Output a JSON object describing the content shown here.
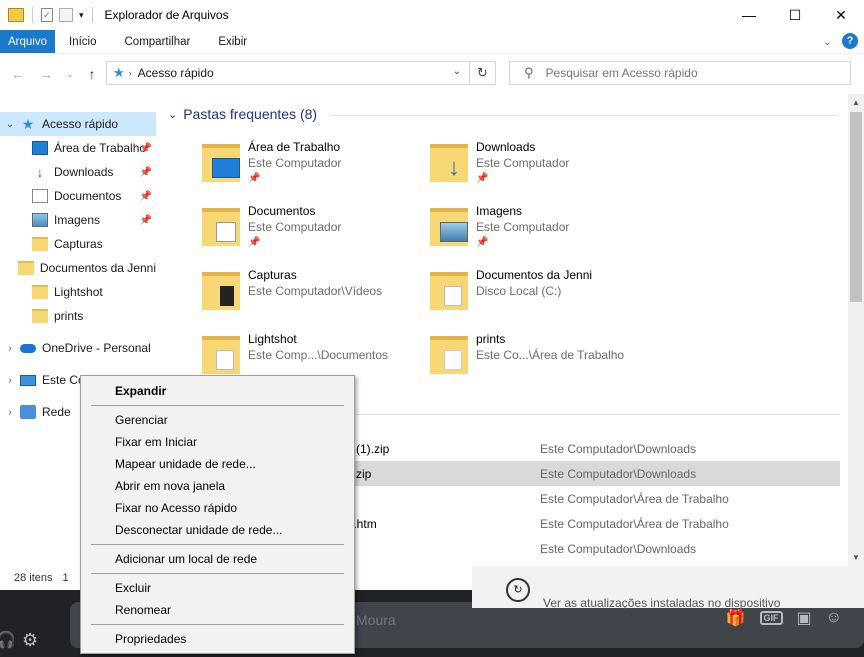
{
  "window": {
    "title": "Explorador de Arquivos",
    "controls": {
      "minimize": "—",
      "maximize": "☐",
      "close": "✕"
    }
  },
  "ribbon": {
    "tabs": [
      "Arquivo",
      "Início",
      "Compartilhar",
      "Exibir"
    ]
  },
  "address": {
    "crumb": "Acesso rápido",
    "search_placeholder": "Pesquisar em Acesso rápido"
  },
  "nav": {
    "quick_access": "Acesso rápido",
    "items": [
      {
        "label": "Área de Trabalho",
        "icon": "desktop-icon",
        "pinned": true
      },
      {
        "label": "Downloads",
        "icon": "download-icon",
        "pinned": true
      },
      {
        "label": "Documentos",
        "icon": "document-icon",
        "pinned": true
      },
      {
        "label": "Imagens",
        "icon": "image-icon",
        "pinned": true
      },
      {
        "label": "Capturas",
        "icon": "folder-icon",
        "pinned": false
      },
      {
        "label": "Documentos da Jenni",
        "icon": "folder-icon",
        "pinned": false
      },
      {
        "label": "Lightshot",
        "icon": "folder-icon",
        "pinned": false
      },
      {
        "label": "prints",
        "icon": "folder-icon",
        "pinned": false
      }
    ],
    "onedrive": "OneDrive - Personal",
    "this_pc": "Este Co",
    "network": "Rede"
  },
  "content": {
    "group_title": "Pastas frequentes (8)",
    "folders": [
      {
        "name": "Área de Trabalho",
        "location": "Este Computador",
        "pinned": true
      },
      {
        "name": "Downloads",
        "location": "Este Computador",
        "pinned": true
      },
      {
        "name": "Documentos",
        "location": "Este Computador",
        "pinned": true
      },
      {
        "name": "Imagens",
        "location": "Este Computador",
        "pinned": true
      },
      {
        "name": "Capturas",
        "location": "Este Computador\\Vídeos",
        "pinned": false
      },
      {
        "name": "Documentos da Jenni",
        "location": "Disco Local (C:)",
        "pinned": false
      },
      {
        "name": "Lightshot",
        "location": "Este Comp...\\Documentos",
        "pinned": false
      },
      {
        "name": "prints",
        "location": "Este Co...\\Área de Trabalho",
        "pinned": false
      }
    ],
    "recent": [
      {
        "name": "ox (1).zip",
        "path": "Este Computador\\Downloads",
        "highlighted": false
      },
      {
        "name": "ox.zip",
        "path": "Este Computador\\Downloads",
        "highlighted": true
      },
      {
        "name": "",
        "path": "Este Computador\\Área de Trabalho",
        "highlighted": false
      },
      {
        "name": "99.htm",
        "path": "Este Computador\\Área de Trabalho",
        "highlighted": false
      },
      {
        "name": "",
        "path": "Este Computador\\Downloads",
        "highlighted": false
      }
    ]
  },
  "status": {
    "count": "28 itens",
    "extra": "1"
  },
  "context_menu": {
    "items": [
      {
        "label": "Expandir",
        "bold": true
      },
      {
        "label": "Gerenciar"
      },
      {
        "label": "Fixar em Iniciar"
      },
      {
        "label": "Mapear unidade de rede..."
      },
      {
        "label": "Abrir em nova janela"
      },
      {
        "label": "Fixar no Acesso rápido"
      },
      {
        "label": "Desconectar unidade de rede..."
      },
      {
        "label": "Adicionar um local de rede"
      },
      {
        "label": "Excluir"
      },
      {
        "label": "Renomear"
      },
      {
        "label": "Propriedades"
      }
    ]
  },
  "background_app": {
    "placeholder": "Moura",
    "update_text": "Ver as atualizações instaladas no dispositivo",
    "gif_label": "GIF"
  },
  "colors": {
    "accent": "#1979ca",
    "selection": "#cce8ff",
    "link": "#1e3287"
  }
}
